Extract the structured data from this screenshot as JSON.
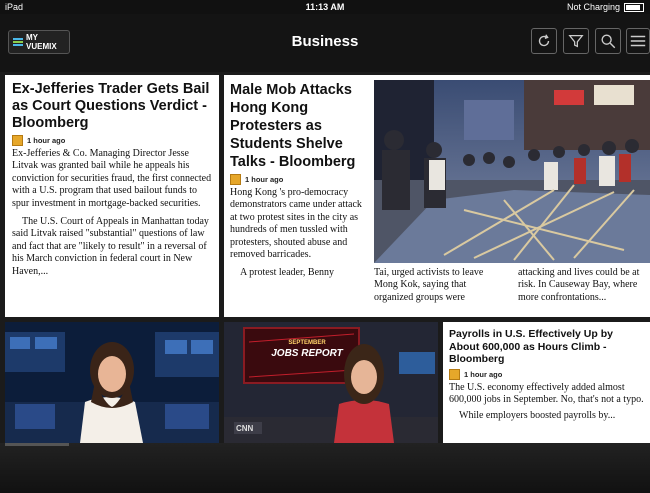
{
  "status": {
    "device": "iPad",
    "time": "11:13 AM",
    "battery": "Not Charging"
  },
  "nav": {
    "logo": "MY VUEMIX",
    "title": "Business"
  },
  "articles": [
    {
      "title": "Ex-Jefferies Trader Gets Bail as Court Questions Verdict - Bloomberg",
      "time": "1 hour ago",
      "p1": "Ex-Jefferies & Co. Managing Director Jesse Litvak was granted bail while he appeals his conviction for securities fraud, the first connected with a U.S. program that used bailout funds to spur investment in mortgage-backed securities.",
      "p2": "The U.S. Court of Appeals in Manhattan today said Litvak raised \"substantial\" questions of law and fact that are \"likely to result\" in a reversal of his March conviction in federal court in New Haven,..."
    },
    {
      "title": "Male Mob Attacks Hong Kong Protesters as Students Shelve Talks - Bloomberg",
      "time": "1 hour ago",
      "p1": "Hong Kong 's pro-democracy demonstrators came under attack at two protest sites in the city as hundreds of men tussled with protesters, shouted abuse and removed barricades.",
      "p2": "A protest leader, Benny",
      "c2": "Tai, urged activists to leave Mong Kok, saying that organized groups were",
      "c3": "attacking and lives could be at risk. In Causeway Bay, where more confrontations..."
    },
    {
      "title": "Payrolls in U.S. Effectively Up by About 600,000 as Hours Climb - Bloomberg",
      "time": "1 hour ago",
      "p1": "The U.S. economy effectively added almost 600,000 jobs in September. No, that's not a typo.",
      "p2": "While employers boosted payrolls by..."
    }
  ],
  "tv": {
    "banner_top": "SEPTEMBER",
    "banner_main": "JOBS REPORT",
    "logo": "CNN"
  }
}
